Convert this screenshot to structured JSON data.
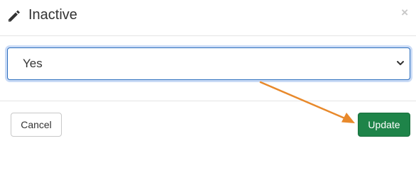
{
  "modal": {
    "title": "Inactive",
    "title_icon": "pencil-icon",
    "close_label": "×",
    "close_icon": "close-icon"
  },
  "field": {
    "selected_value": "Yes",
    "chevron_icon": "chevron-down-icon"
  },
  "footer": {
    "cancel_label": "Cancel",
    "update_label": "Update"
  },
  "colors": {
    "update_button": "#1e8449",
    "focus_border": "#2c6ebd",
    "annotation_arrow": "#e8892b"
  }
}
